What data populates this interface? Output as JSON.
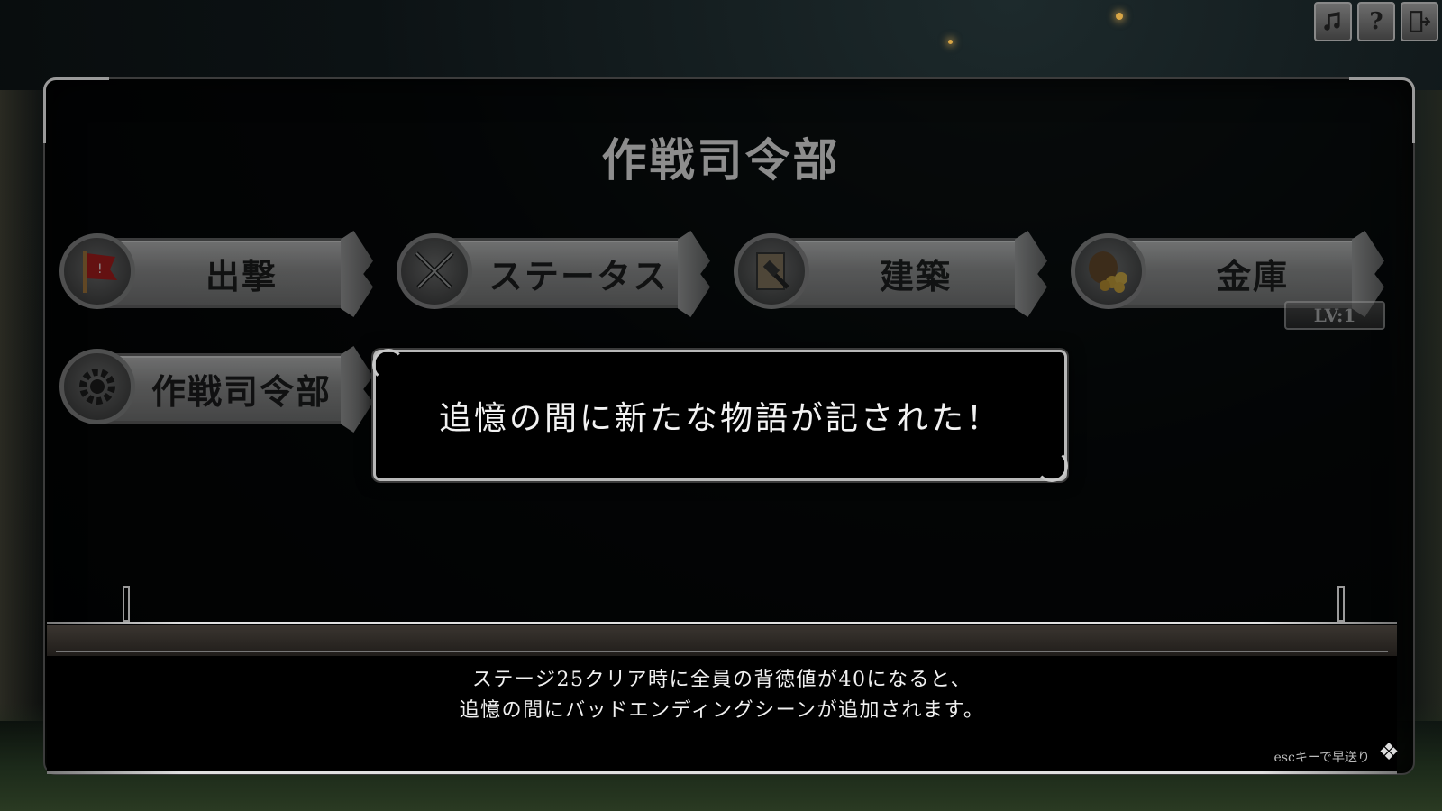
{
  "system_buttons": {
    "music_icon": "music-note-icon",
    "help_label": "?",
    "exit_icon": "exit-door-icon"
  },
  "screen": {
    "title": "作戦司令部"
  },
  "menu": {
    "items": [
      {
        "label": "出撃",
        "icon": "red-flag-icon"
      },
      {
        "label": "ステータス",
        "icon": "crossed-swords-icon"
      },
      {
        "label": "建築",
        "icon": "hammer-scroll-icon"
      },
      {
        "label": "金庫",
        "icon": "gold-coins-bag-icon",
        "level": "LV:1"
      },
      {
        "label": "作戦司令部",
        "icon": "gear-icon"
      }
    ]
  },
  "notification": {
    "text": "追憶の間に新たな物語が記された！"
  },
  "message": {
    "line1": "ステージ25クリア時に全員の背徳値が40になると、",
    "line2": "追憶の間にバッドエンディングシーンが追加されます。",
    "skip_hint": "escキーで早送り"
  }
}
